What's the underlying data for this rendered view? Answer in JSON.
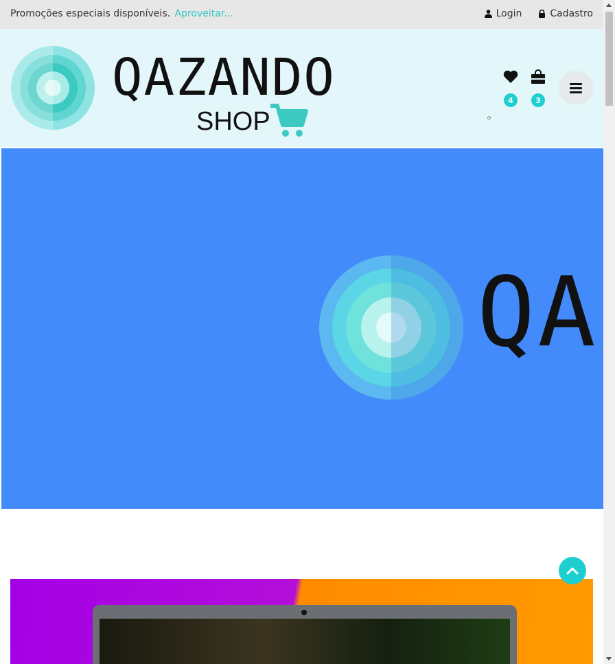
{
  "topbar": {
    "promo_text": "Promoções especiais disponíveis.",
    "promo_link": "Aproveitar...",
    "login_label": "Login",
    "signup_label": "Cadastro"
  },
  "header": {
    "brand_name": "QAZANDO",
    "brand_sub": "SHOP",
    "wishlist_count": "4",
    "cart_count": "3"
  },
  "hero": {
    "brand_name": "QAZ"
  },
  "colors": {
    "accent": "#1fcfcf",
    "hero_bg": "#438bfb",
    "header_bg": "#e3f6fa"
  },
  "icons": [
    "user-icon",
    "lock-icon",
    "heart-icon",
    "shopping-bag-icon",
    "hamburger-menu-icon",
    "chevron-up-icon",
    "cart-icon"
  ]
}
